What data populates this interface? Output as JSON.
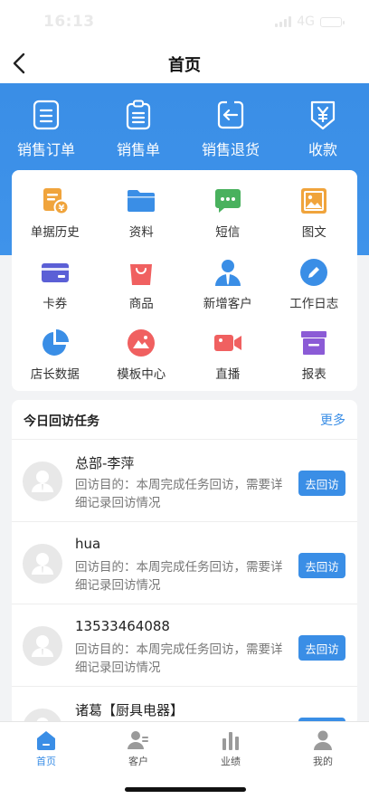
{
  "status_bar": {
    "time": "16:13",
    "network": "4G"
  },
  "nav": {
    "title": "首页"
  },
  "quick_actions": [
    {
      "label": "销售订单",
      "icon": "order-icon"
    },
    {
      "label": "销售单",
      "icon": "clipboard-icon"
    },
    {
      "label": "销售退货",
      "icon": "return-icon"
    },
    {
      "label": "收款",
      "icon": "yen-icon"
    }
  ],
  "grid": [
    {
      "label": "单据历史",
      "icon": "document-history-icon",
      "color": "#f0a43c"
    },
    {
      "label": "资料",
      "icon": "folder-icon",
      "color": "#3a8ee6"
    },
    {
      "label": "短信",
      "icon": "message-icon",
      "color": "#49b15e"
    },
    {
      "label": "图文",
      "icon": "image-icon",
      "color": "#f0a43c"
    },
    {
      "label": "卡券",
      "icon": "card-icon",
      "color": "#5b5fd6"
    },
    {
      "label": "商品",
      "icon": "shopping-bag-icon",
      "color": "#f06060"
    },
    {
      "label": "新增客户",
      "icon": "add-customer-icon",
      "color": "#3a8ee6"
    },
    {
      "label": "工作日志",
      "icon": "pencil-icon",
      "color": "#3a8ee6"
    },
    {
      "label": "店长数据",
      "icon": "pie-chart-icon",
      "color": "#3a8ee6"
    },
    {
      "label": "模板中心",
      "icon": "template-icon",
      "color": "#f06060"
    },
    {
      "label": "直播",
      "icon": "video-icon",
      "color": "#f06060"
    },
    {
      "label": "报表",
      "icon": "report-icon",
      "color": "#8b5bd6"
    }
  ],
  "visits": {
    "title": "今日回访任务",
    "more": "更多",
    "button_label": "去回访",
    "items": [
      {
        "name": "总部-李萍",
        "desc": "回访目的：本周完成任务回访，需要详细记录回访情况"
      },
      {
        "name": "hua",
        "desc": "回访目的：本周完成任务回访，需要详细记录回访情况"
      },
      {
        "name": "13533464088",
        "desc": "回访目的：本周完成任务回访，需要详细记录回访情况"
      },
      {
        "name": "诸葛【厨具电器】",
        "desc": ""
      }
    ]
  },
  "tabs": [
    {
      "label": "首页",
      "icon": "home-icon",
      "active": true
    },
    {
      "label": "客户",
      "icon": "customer-icon",
      "active": false
    },
    {
      "label": "业绩",
      "icon": "bar-chart-icon",
      "active": false
    },
    {
      "label": "我的",
      "icon": "profile-icon",
      "active": false
    }
  ],
  "colors": {
    "primary": "#3a8ee6"
  }
}
